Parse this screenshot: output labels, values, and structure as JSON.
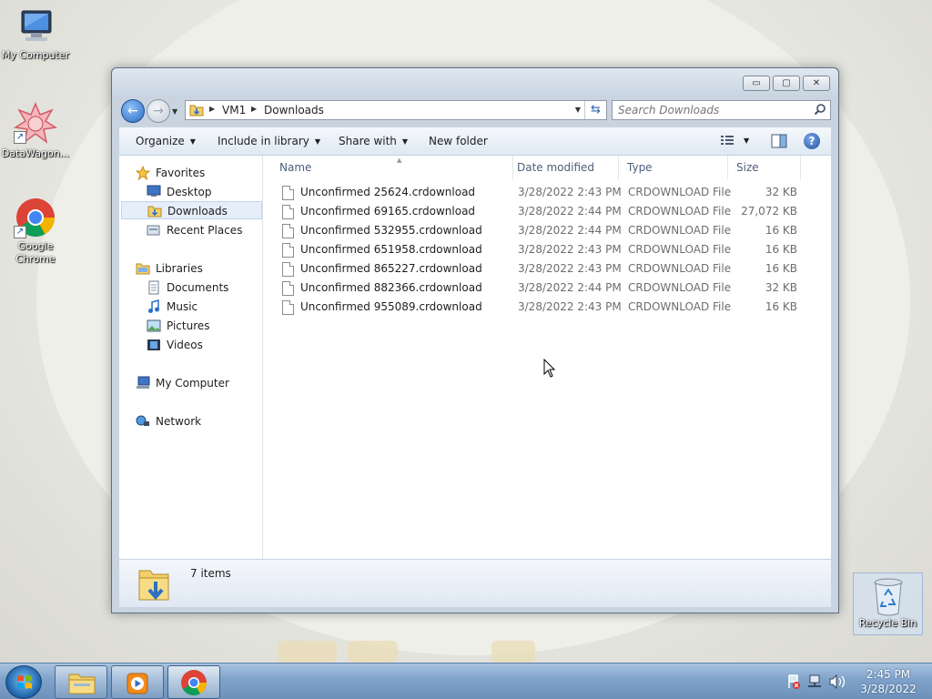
{
  "desktop": {
    "icons": [
      {
        "label": "My Computer",
        "icon": "computer-icon"
      },
      {
        "label": "DataWagon...",
        "icon": "datawagon-icon"
      },
      {
        "label": "Google Chrome",
        "icon": "chrome-icon"
      }
    ],
    "recycle_bin": {
      "label": "Recycle Bin",
      "icon": "recycle-bin-icon"
    }
  },
  "window": {
    "caption_buttons": {
      "minimize": "▭",
      "maximize": "▢",
      "close": "✕"
    },
    "breadcrumb": [
      "VM1",
      "Downloads"
    ],
    "search_placeholder": "Search Downloads",
    "commands": {
      "organize": "Organize",
      "include_in_library": "Include in library",
      "share_with": "Share with",
      "new_folder": "New folder"
    },
    "help": "?",
    "nav_pane": {
      "favorites": "Favorites",
      "desktop": "Desktop",
      "downloads": "Downloads",
      "recent_places": "Recent Places",
      "libraries": "Libraries",
      "documents": "Documents",
      "music": "Music",
      "pictures": "Pictures",
      "videos": "Videos",
      "my_computer": "My Computer",
      "network": "Network"
    },
    "columns": {
      "name": "Name",
      "date": "Date modified",
      "type": "Type",
      "size": "Size"
    },
    "files": [
      {
        "name": "Unconfirmed 25624.crdownload",
        "date": "3/28/2022 2:43 PM",
        "type": "CRDOWNLOAD File",
        "size": "32 KB"
      },
      {
        "name": "Unconfirmed 69165.crdownload",
        "date": "3/28/2022 2:44 PM",
        "type": "CRDOWNLOAD File",
        "size": "27,072 KB"
      },
      {
        "name": "Unconfirmed 532955.crdownload",
        "date": "3/28/2022 2:44 PM",
        "type": "CRDOWNLOAD File",
        "size": "16 KB"
      },
      {
        "name": "Unconfirmed 651958.crdownload",
        "date": "3/28/2022 2:43 PM",
        "type": "CRDOWNLOAD File",
        "size": "16 KB"
      },
      {
        "name": "Unconfirmed 865227.crdownload",
        "date": "3/28/2022 2:43 PM",
        "type": "CRDOWNLOAD File",
        "size": "16 KB"
      },
      {
        "name": "Unconfirmed 882366.crdownload",
        "date": "3/28/2022 2:44 PM",
        "type": "CRDOWNLOAD File",
        "size": "32 KB"
      },
      {
        "name": "Unconfirmed 955089.crdownload",
        "date": "3/28/2022 2:43 PM",
        "type": "CRDOWNLOAD File",
        "size": "16 KB"
      }
    ],
    "status": {
      "item_count": "7 items"
    }
  },
  "taskbar": {
    "clock_time": "2:45 PM",
    "clock_date": "3/28/2022",
    "pinned": [
      "windows-explorer-icon",
      "media-player-icon",
      "chrome-icon"
    ]
  },
  "colors": {
    "accent": "#2a6ac4",
    "taskbar": "#7fa2c9",
    "selection": "#e5eef9"
  }
}
